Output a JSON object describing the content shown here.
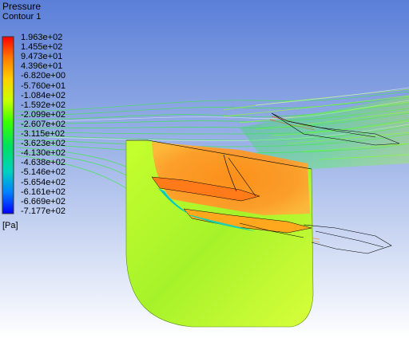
{
  "legend": {
    "title": "Pressure",
    "subtitle": "Contour 1",
    "units": "[Pa]",
    "labels": [
      "1.963e+02",
      "1.455e+02",
      "9.473e+01",
      "4.396e+01",
      "-6.820e+00",
      "-5.760e+01",
      "-1.084e+02",
      "-1.592e+02",
      "-2.099e+02",
      "-2.607e+02",
      "-3.115e+02",
      "-3.623e+02",
      "-4.130e+02",
      "-4.638e+02",
      "-5.146e+02",
      "-5.654e+02",
      "-6.161e+02",
      "-6.669e+02",
      "-7.177e+02"
    ],
    "colormap": [
      "#ff0000",
      "#ff7a00",
      "#ffd000",
      "#c8ff00",
      "#3cff00",
      "#00e060",
      "#00d0c0",
      "#0080ff",
      "#0000ff"
    ]
  },
  "colors": {
    "background_top": "#5b7fd8",
    "background_bottom": "#ffffff",
    "high_pressure": "#ff9a2a",
    "mid_pressure": "#b8ff1e",
    "low_pressure": "#00c8c8"
  }
}
